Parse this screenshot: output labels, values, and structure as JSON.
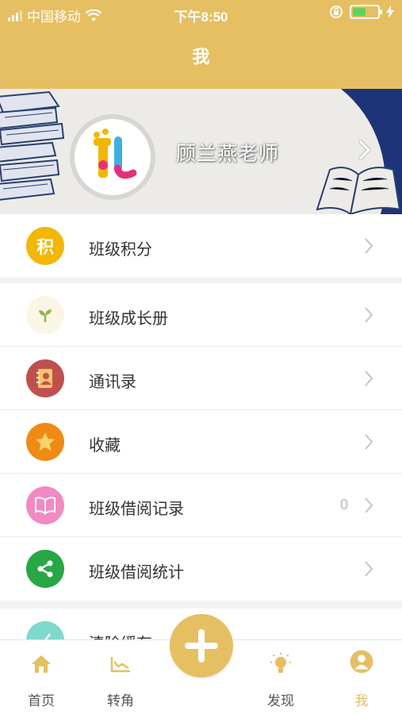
{
  "status_bar": {
    "carrier": "中国移动",
    "time": "下午8:50"
  },
  "header": {
    "title": "我"
  },
  "profile": {
    "name": "顾兰燕老师"
  },
  "menu_groups": [
    [
      {
        "label": "班级积分",
        "icon": "points-icon",
        "icon_text": "积",
        "icon_color": "#f2b705"
      }
    ],
    [
      {
        "label": "班级成长册",
        "icon": "sprout-icon",
        "icon_color": "#fbf5e6"
      },
      {
        "label": "通讯录",
        "icon": "contacts-book-icon",
        "icon_color": "#c0504d"
      },
      {
        "label": "收藏",
        "icon": "star-icon",
        "icon_color": "#ef8a14"
      },
      {
        "label": "班级借阅记录",
        "icon": "open-book-icon",
        "icon_color": "#f28ac2",
        "count": "0"
      },
      {
        "label": "班级借阅统计",
        "icon": "share-icon",
        "icon_color": "#28a745"
      }
    ],
    [
      {
        "label": "清除缓存",
        "icon": "broom-icon",
        "icon_color": "#7fd9cc"
      }
    ]
  ],
  "tabbar": {
    "tabs": [
      {
        "label": "首页",
        "icon": "home-icon",
        "active": false
      },
      {
        "label": "转角",
        "icon": "chart-icon",
        "active": false
      },
      {
        "label": "发现",
        "icon": "bulb-icon",
        "active": false
      },
      {
        "label": "我",
        "icon": "profile-icon",
        "active": true
      }
    ],
    "center_button": {
      "icon": "plus-icon"
    }
  },
  "colors": {
    "accent": "#e6bf62",
    "background": "#f2f2f2"
  }
}
